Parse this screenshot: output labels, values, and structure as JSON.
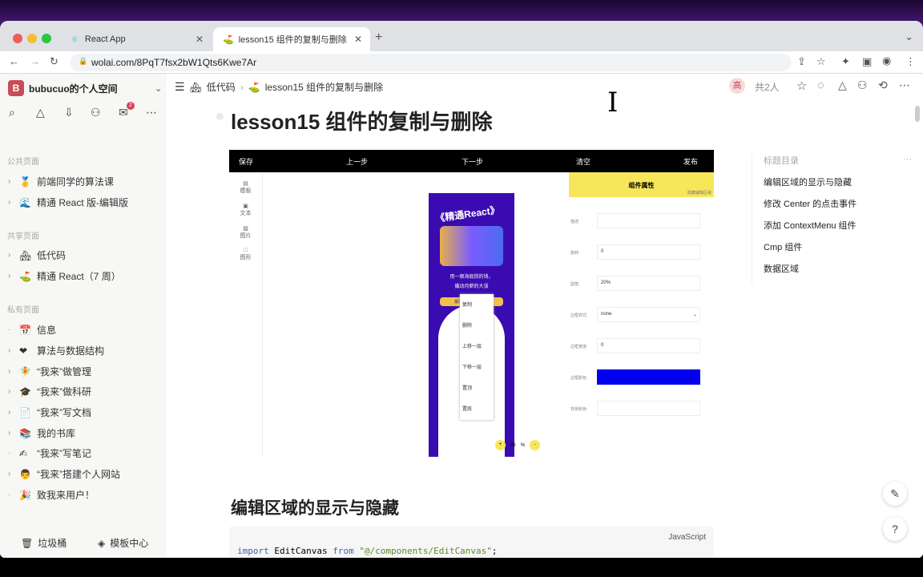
{
  "browser": {
    "tabs": [
      {
        "label": "React App"
      },
      {
        "label": "lesson15 组件的复制与删除"
      }
    ],
    "url": "wolai.com/8PqT7fsx2bW1Qts6Kwe7Ar"
  },
  "sidebar": {
    "workspace": "bubucuo的个人空间",
    "workspace_initial": "B",
    "inbox_badge": "2",
    "sections": [
      {
        "title": "公共页面"
      },
      {
        "title": "共享页面"
      },
      {
        "title": "私有页面"
      }
    ],
    "items": [
      {
        "label": "前端同学的算法课",
        "icon": "🥇"
      },
      {
        "label": "精通 React 版-编辑版",
        "icon": "🌊"
      },
      {
        "label": "低代码",
        "icon": "🏘"
      },
      {
        "label": "精通 React（7 周）",
        "icon": "⛳"
      },
      {
        "label": "信息",
        "icon": "📅"
      },
      {
        "label": "算法与数据结构",
        "icon": "❤"
      },
      {
        "label": "“我来”做管理",
        "icon": "🧚"
      },
      {
        "label": "“我来”做科研",
        "icon": "🎓"
      },
      {
        "label": "“我来”写文档",
        "icon": "📄"
      },
      {
        "label": "我的书库",
        "icon": "📚"
      },
      {
        "label": "“我来”写笔记",
        "icon": "✍"
      },
      {
        "label": "“我来”搭建个人网站",
        "icon": "👨"
      },
      {
        "label": "致我来用户！",
        "icon": "🎉"
      }
    ],
    "trash": "垃圾桶",
    "templates": "模板中心"
  },
  "header": {
    "crumbs": [
      "低代码",
      "lesson15 组件的复制与删除"
    ],
    "avatar": "高",
    "members": "共2人"
  },
  "page": {
    "title": "lesson15 组件的复制与删除",
    "h2": "编辑区域的显示与隐藏",
    "code_lang": "JavaScript",
    "code": {
      "kw1": "import",
      "name": " EditCanvas ",
      "kw2": "from",
      "str": " \"@/components/EditCanvas\"",
      "end": ";"
    }
  },
  "editor": {
    "toolbar": [
      "保存",
      "上一步",
      "下一步",
      "清空",
      "发布"
    ],
    "left": [
      "模板",
      "文本",
      "图片",
      "图形"
    ],
    "poster_title": "《精通React》",
    "poster_sub1": "用一顿海底捞的钱，",
    "poster_sub2": "撬动月薪的大涨",
    "poster_btn": "最硬核的React课程",
    "context_menu": [
      "复制",
      "删除",
      "上移一层",
      "下移一层",
      "置顶",
      "置底"
    ],
    "zoom": "26",
    "zoom_unit": "%",
    "zoom_plus": "+",
    "zoom_minus": "-",
    "panel_title": "组件属性",
    "panel_hide": "隐藏编辑区域",
    "props": [
      {
        "label": "描述:",
        "value": ""
      },
      {
        "label": "旋转:",
        "value": "0"
      },
      {
        "label": "圆角:",
        "value": "20%"
      },
      {
        "label": "边框样式:",
        "value": "none"
      },
      {
        "label": "边框宽度:",
        "value": "0"
      },
      {
        "label": "边框颜色:",
        "value": ""
      },
      {
        "label": "背景颜色:",
        "value": ""
      }
    ],
    "border_color": "#0000ee"
  },
  "toc": {
    "title": "标题目录",
    "items": [
      "编辑区域的显示与隐藏",
      "修改 Center 的点击事件",
      "添加 ContextMenu 组件",
      "Cmp 组件",
      "数据区域"
    ]
  }
}
